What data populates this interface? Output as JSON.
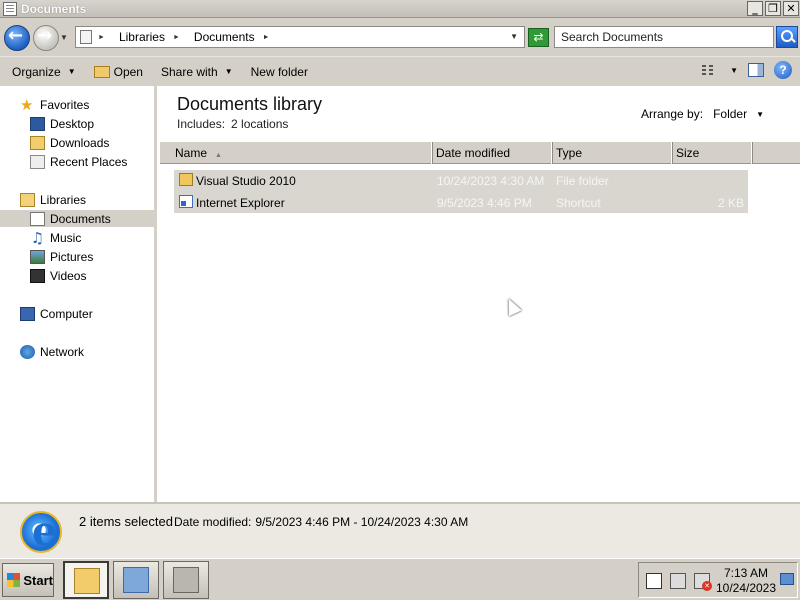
{
  "window": {
    "title": "Documents",
    "buttons": {
      "minimize": "_",
      "maximize": "❐",
      "close": "✕"
    }
  },
  "address": {
    "breadcrumbs": [
      "Libraries",
      "Documents"
    ],
    "search_placeholder": "Search Documents"
  },
  "toolbar": {
    "organize": "Organize",
    "open": "Open",
    "share_with": "Share with",
    "new_folder": "New folder"
  },
  "nav": {
    "favorites": {
      "label": "Favorites",
      "items": [
        "Desktop",
        "Downloads",
        "Recent Places"
      ]
    },
    "libraries": {
      "label": "Libraries",
      "items": [
        "Documents",
        "Music",
        "Pictures",
        "Videos"
      ],
      "selected": "Documents"
    },
    "computer": "Computer",
    "network": "Network"
  },
  "library": {
    "title": "Documents library",
    "includes_label": "Includes:",
    "includes_value": "2 locations",
    "arrange_label": "Arrange by:",
    "arrange_value": "Folder"
  },
  "columns": [
    "Name",
    "Date modified",
    "Type",
    "Size"
  ],
  "files": [
    {
      "name": "Visual Studio 2010",
      "date": "10/24/2023 4:30 AM",
      "type": "File folder",
      "size": "",
      "icon": "folder-icon"
    },
    {
      "name": "Internet Explorer",
      "date": "9/5/2023 4:46 PM",
      "type": "Shortcut",
      "size": "2 KB",
      "icon": "shortcut-icon"
    }
  ],
  "details": {
    "selection": "2 items selected",
    "date_label": "Date modified:",
    "date_value": "9/5/2023 4:46 PM - 10/24/2023 4:30 AM"
  },
  "taskbar": {
    "start": "Start",
    "clock_time": "7:13 AM",
    "clock_date": "10/24/2023"
  }
}
